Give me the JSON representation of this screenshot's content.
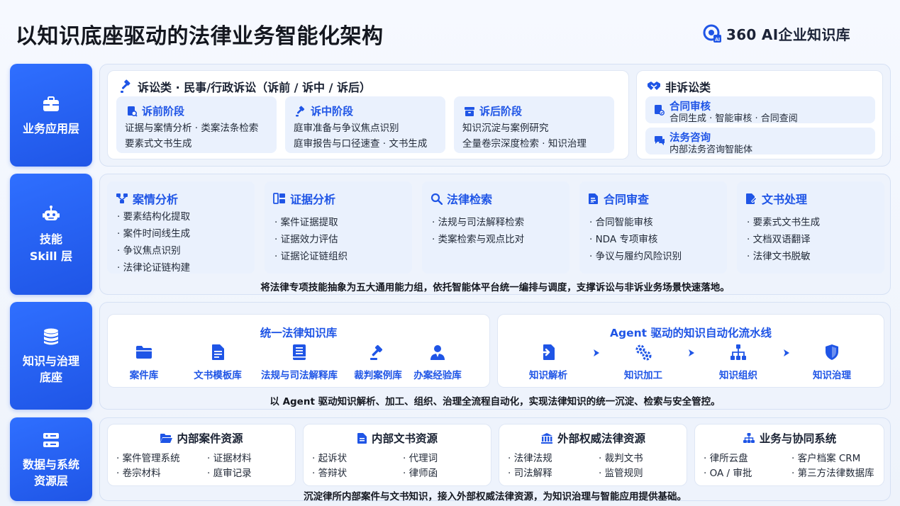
{
  "header": {
    "title": "以知识底座驱动的法律业务智能化架构",
    "logo_text": "360 AI企业知识库"
  },
  "colors": {
    "accent": "#1f55e6",
    "panel_bg": "#eef3fc",
    "subcard_bg": "#eaf1fd"
  },
  "layers": {
    "business": {
      "label": "业务应用层",
      "litigation": {
        "title": "诉讼类 · 民事/行政诉讼（诉前 / 诉中 / 诉后）",
        "phases": [
          {
            "title": "诉前阶段",
            "icon": "document-search-icon",
            "lines": [
              "证据与案情分析 · 类案法条检索",
              "要素式文书生成"
            ]
          },
          {
            "title": "诉中阶段",
            "icon": "gavel-icon",
            "lines": [
              "庭审准备与争议焦点识别",
              "庭审报告与口径速查 · 文书生成"
            ]
          },
          {
            "title": "诉后阶段",
            "icon": "archive-icon",
            "lines": [
              "知识沉淀与案例研究",
              "全量卷宗深度检索 · 知识治理"
            ]
          }
        ]
      },
      "non_litigation": {
        "title": "非诉讼类",
        "items": [
          {
            "title": "合同审核",
            "icon": "contract-icon",
            "desc": "合同生成 · 智能审核 · 合同查阅"
          },
          {
            "title": "法务咨询",
            "icon": "chat-icon",
            "desc": "内部法务咨询智能体"
          }
        ]
      }
    },
    "skill": {
      "label": "技能\nSkill 层",
      "skills": [
        {
          "title": "案情分析",
          "icon": "structure-icon",
          "items": [
            "· 要素结构化提取",
            "· 案件时间线生成",
            "· 争议焦点识别",
            "· 法律论证链构建"
          ]
        },
        {
          "title": "证据分析",
          "icon": "evidence-icon",
          "items": [
            "· 案件证据提取",
            "· 证据效力评估",
            "· 证据论证链组织"
          ]
        },
        {
          "title": "法律检索",
          "icon": "search-icon",
          "items": [
            "· 法规与司法解释检索",
            "· 类案检索与观点比对"
          ]
        },
        {
          "title": "合同审查",
          "icon": "contract-review-icon",
          "items": [
            "· 合同智能审核",
            "· NDA 专项审核",
            "· 争议与履约风险识别"
          ]
        },
        {
          "title": "文书处理",
          "icon": "document-edit-icon",
          "items": [
            "· 要素式文书生成",
            "· 文档双语翻译",
            "· 法律文书脱敏"
          ]
        }
      ],
      "caption": "将法律专项技能抽象为五大通用能力组，依托智能体平台统一编排与调度，支撑诉讼与非诉业务场景快速落地。"
    },
    "knowledge": {
      "label": "知识与治理\n底座",
      "unified_kb": {
        "title": "统一法律知识库",
        "items": [
          {
            "label": "案件库",
            "icon": "folder-icon"
          },
          {
            "label": "文书模板库",
            "icon": "document-icon"
          },
          {
            "label": "法规与司法解释库",
            "icon": "law-book-icon"
          },
          {
            "label": "裁判案例库",
            "icon": "gavel-icon"
          },
          {
            "label": "办案经验库",
            "icon": "lawyer-icon"
          }
        ]
      },
      "pipeline": {
        "title": "Agent 驱动的知识自动化流水线",
        "steps": [
          {
            "label": "知识解析",
            "icon": "import-icon"
          },
          {
            "label": "知识加工",
            "icon": "gears-icon"
          },
          {
            "label": "知识组织",
            "icon": "hierarchy-icon"
          },
          {
            "label": "知识治理",
            "icon": "shield-icon"
          }
        ]
      },
      "caption": "以 Agent 驱动知识解析、加工、组织、治理全流程自动化，实现法律知识的统一沉淀、检索与安全管控。"
    },
    "data": {
      "label": "数据与系统\n资源层",
      "resources": [
        {
          "title": "内部案件资源",
          "icon": "folder-open-icon",
          "items": [
            "· 案件管理系统",
            "· 证据材料",
            "· 卷宗材料",
            "· 庭审记录"
          ]
        },
        {
          "title": "内部文书资源",
          "icon": "document-icon",
          "items": [
            "· 起诉状",
            "· 代理词",
            "· 答辩状",
            "· 律师函"
          ]
        },
        {
          "title": "外部权威法律资源",
          "icon": "institution-icon",
          "items": [
            "· 法律法规",
            "· 裁判文书",
            "· 司法解释",
            "· 监管规则"
          ]
        },
        {
          "title": "业务与协同系统",
          "icon": "network-icon",
          "items": [
            "· 律所云盘",
            "· 客户档案 CRM",
            "· OA / 审批",
            "· 第三方法律数据库"
          ]
        }
      ],
      "caption": "沉淀律所内部案件与文书知识，接入外部权威法律资源，为知识治理与智能应用提供基础。"
    }
  }
}
